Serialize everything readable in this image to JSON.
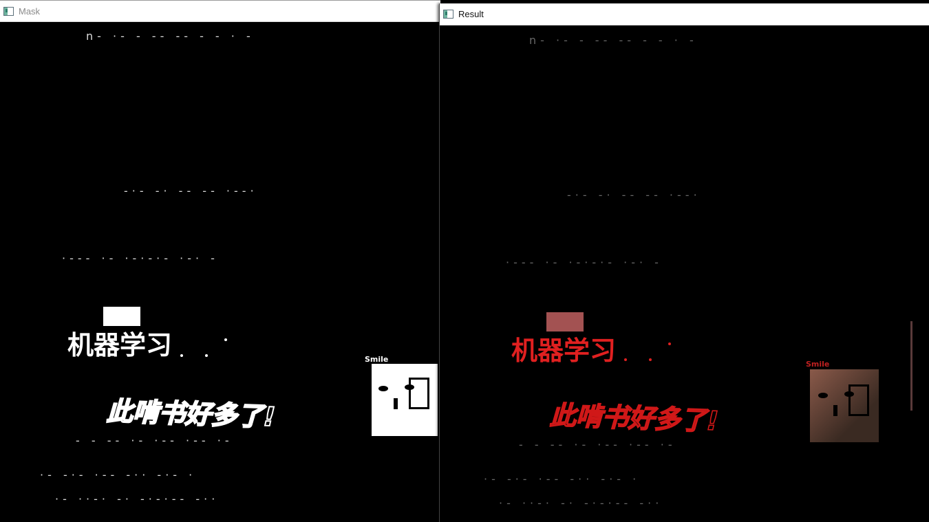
{
  "mask_window": {
    "title": "Mask",
    "headline": "机器学习",
    "slogan": "此啃书好多了!",
    "face_label": "Smile",
    "noise_rows": [
      "n- ·-  -  -- -- - -  ·  -",
      "-·- -·     -- --     ·--·",
      "·--- ·-    ·-·-·-    ·-· -",
      "- -  --  ·-  ·--  ·-- ·-",
      "·- -·-  ·--  -·· -·- ·",
      "·- ··-· -·  -·-·--  -··"
    ]
  },
  "result_window": {
    "title": "Result",
    "headline": "机器学习",
    "slogan": "此啃书好多了!",
    "face_label": "Smile",
    "noise_rows": [
      "n- ·-  -  -- -- - -  ·  -",
      "-·- -·     -- --     ·--·",
      "·--- ·-    ·-·-·-    ·-· -",
      "- -  --  ·-  ·--  ·-- ·-",
      "·- -·-  ·--  -·· -·- ·",
      "·- ··-· -·  -·-·--  -··"
    ]
  }
}
